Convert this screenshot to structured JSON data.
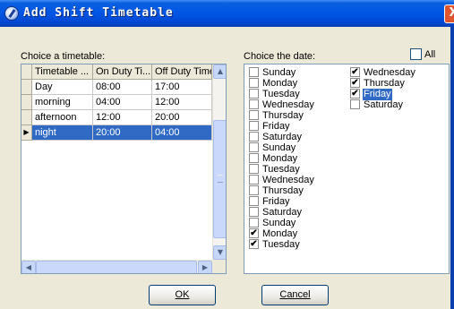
{
  "window": {
    "title": "Add Shift Timetable",
    "close_glyph": "X",
    "title_icon": "clock-icon"
  },
  "timetable": {
    "label": "Choice a timetable:",
    "columns": [
      "Timetable ...",
      "On Duty Ti...",
      "Off Duty Time"
    ],
    "rows": [
      {
        "indicator": "",
        "name": "Day",
        "on": "08:00",
        "off": "17:00"
      },
      {
        "indicator": "",
        "name": "morning",
        "on": "04:00",
        "off": "12:00"
      },
      {
        "indicator": "",
        "name": "afternoon",
        "on": "12:00",
        "off": "20:00"
      },
      {
        "indicator": "▶",
        "name": "night",
        "on": "20:00",
        "off": "04:00"
      }
    ],
    "selected_row": 3,
    "scroll": {
      "up": "▲",
      "down": "▼",
      "left": "◀",
      "right": "▶"
    }
  },
  "dates": {
    "label": "Choice the date:",
    "all_label": "All",
    "all_checked": false,
    "check_glyph": "✔",
    "col1": [
      {
        "label": "Sunday",
        "checked": false
      },
      {
        "label": "Monday",
        "checked": false
      },
      {
        "label": "Tuesday",
        "checked": false
      },
      {
        "label": "Wednesday",
        "checked": false
      },
      {
        "label": "Thursday",
        "checked": false
      },
      {
        "label": "Friday",
        "checked": false
      },
      {
        "label": "Saturday",
        "checked": false
      },
      {
        "label": "Sunday",
        "checked": false
      },
      {
        "label": "Monday",
        "checked": false
      },
      {
        "label": "Tuesday",
        "checked": false
      },
      {
        "label": "Wednesday",
        "checked": false
      },
      {
        "label": "Thursday",
        "checked": false
      },
      {
        "label": "Friday",
        "checked": false
      },
      {
        "label": "Saturday",
        "checked": false
      },
      {
        "label": "Sunday",
        "checked": false
      },
      {
        "label": "Monday",
        "checked": true
      },
      {
        "label": "Tuesday",
        "checked": true
      }
    ],
    "col2": [
      {
        "label": "Wednesday",
        "checked": true
      },
      {
        "label": "Thursday",
        "checked": true
      },
      {
        "label": "Friday",
        "checked": true,
        "selected": true
      },
      {
        "label": "Saturday",
        "checked": false
      }
    ]
  },
  "buttons": {
    "ok": "OK",
    "cancel": "Cancel"
  },
  "colors": {
    "titlebar": "#0055e5",
    "selection": "#316ac5",
    "dialog_bg": "#ece9d8"
  }
}
